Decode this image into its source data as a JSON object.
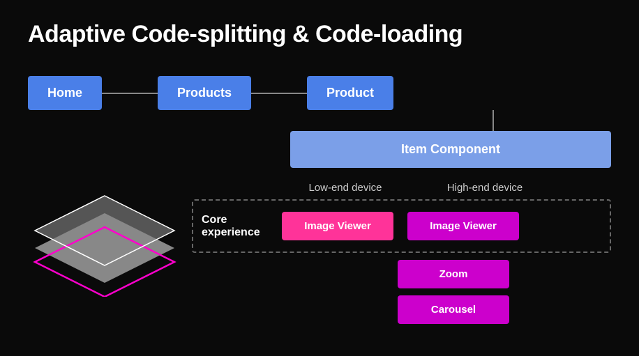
{
  "title": "Adaptive Code-splitting & Code-loading",
  "routes": {
    "home": "Home",
    "products": "Products",
    "product": "Product",
    "item_component": "Item Component"
  },
  "device_labels": {
    "low_end": "Low-end device",
    "high_end": "High-end device"
  },
  "sections": {
    "core_label": "Core experience",
    "image_viewer_low": "Image Viewer",
    "image_viewer_high": "Image Viewer",
    "zoom": "Zoom",
    "carousel": "Carousel"
  },
  "colors": {
    "background": "#0a0a0a",
    "route_blue": "#4a7fe8",
    "item_component_blue": "#7b9fe8",
    "pink_btn": "#ff3399",
    "magenta_btn": "#cc00cc",
    "connector": "#888888",
    "dashed_border": "#666666"
  }
}
